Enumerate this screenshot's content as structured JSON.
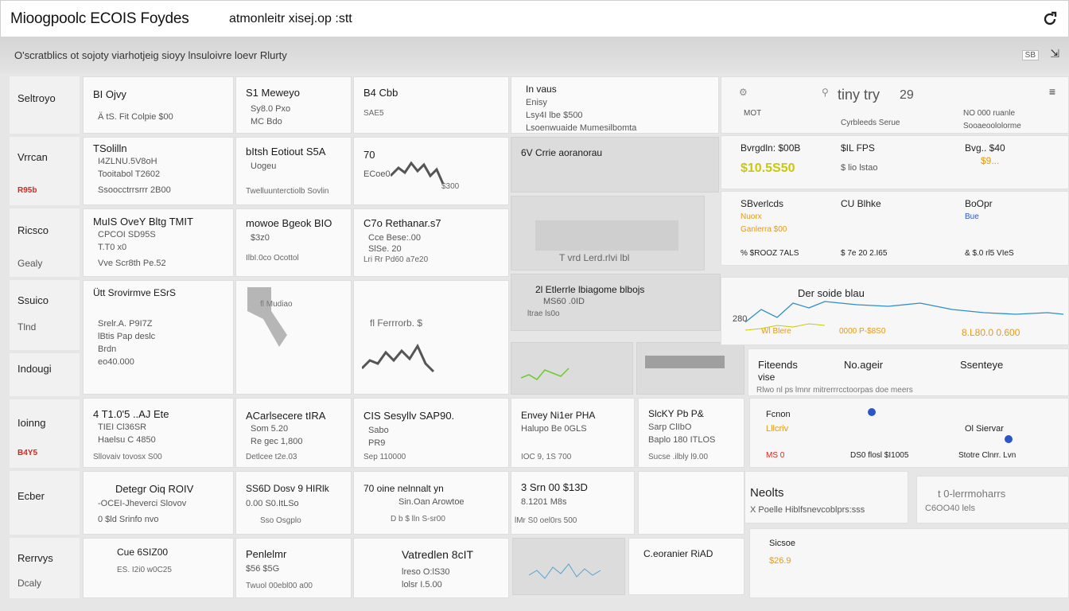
{
  "window": {
    "title": "Mioogpoolc  ECOIS  Foydes",
    "subtitle": "atmonleitr xisej.op :stt",
    "refresh_icon": "refresh-icon"
  },
  "subbar": {
    "text": "O'scratblics ot sojoty viarhotjeig sioyy lnsuloivre loevr Rlurty",
    "badge": "SB",
    "collapse_icon": "collapse-icon"
  },
  "rows": [
    {
      "label": "Seltroyo"
    },
    {
      "label": "Vrrcan",
      "sub": "R95b"
    },
    {
      "label": "Ricsco",
      "sub": "Gealy"
    },
    {
      "label": "Ssuico",
      "sub": "Tlnd"
    },
    {
      "label": "Indougi"
    },
    {
      "label": "Ioinng",
      "sub": "B4Y5"
    },
    {
      "label": "Ecber"
    },
    {
      "label": "Rerrvys",
      "sub": "Dcaly"
    }
  ],
  "cells": {
    "r1c1": {
      "h": "BI Ojvy",
      "l1": "Ä  tS. Fit Colpie $00"
    },
    "r1c2": {
      "h": "S1 Meweyo",
      "l1": "Sy8.0 Pxo",
      "l2": "MC Bdo"
    },
    "r1c3": {
      "h": "B4  Cbb",
      "l1": "SAE5"
    },
    "r1c4": {
      "h": "In vaus",
      "l1": "Enisy",
      "l2": "Lsy4I lbe  $500",
      "l3": "Lsoenwuaide Mumesilbomta"
    },
    "r2c1": {
      "h": "TSolilln",
      "l1": "I4ZLNU.5V8oH",
      "l2": "Tooitabol T2602",
      "l3": "Ssoocctrrsrrr 2B00"
    },
    "r2c2": {
      "h": "bItsh Eotiout S5A",
      "l1": "Uogeu",
      "l2": "Twelluunterctiolb Sovlin"
    },
    "r2c3": {
      "h": "70",
      "l1": "ECoe0",
      "l2": "$300"
    },
    "r2c4": {
      "h": "6V  Crrie aoranorau"
    },
    "r3c1": {
      "h": "MuIS OveY  Bltg TMIT",
      "l1": "CPCOI SD95S",
      "l2": "T.T0 x0",
      "l3": "Vve Scr8th Pe.52"
    },
    "r3c2": {
      "h": "mowoe  Bgeok BIO",
      "l1": "$3z0",
      "l2": "IlbI.0co Ocottol"
    },
    "r3c3": {
      "h": "C7o  Rethanar.s7",
      "l1": "Cce Bese:.00",
      "l2": "SlSe. 20",
      "l3": "Lri  Rr Pd60 a7e20"
    },
    "r3c4": {
      "h": "T  vrd  Lerd.rlvi lbl"
    },
    "r4c1": {
      "h": "Ütt  Srovirmve ESrS",
      "l1": "Srelr.A.  P9I7Z",
      "l2": "lBtis Pap deslc",
      "l3": "Brdn",
      "l4": "eo40.000"
    },
    "r4c2": {
      "h": "fl Mudiao"
    },
    "r4c3": {
      "h": "fl  Ferrrorb. $"
    },
    "r4c4": {
      "h": "2l  Etlerrle lbiagome blbojs",
      "l1": "MS60 .0ID",
      "l2": "ltrae ls0o"
    },
    "r5c1": {
      "h": "4  T1.0'5 ..AJ Ete",
      "l1": "TIEI  Cl36SR",
      "l2": "Haelsu C 4850",
      "l3": "Sllovaiv tovosx S00"
    },
    "r5c2": {
      "h": "ACarlsecere  tIRA",
      "l1": "Som 5.20",
      "l2": "Re gec 1,800",
      "l3": "Detlcee t2e.03"
    },
    "r5c3": {
      "h": "CIS  Sesyllv SAP90.",
      "l1": "Sabo",
      "l2": "PR9 ",
      "l3": "Sep 110000"
    },
    "r5c4": {
      "h": "Envey Ni1er PHA",
      "l1": "Halupo Be 0GLS",
      "l2": "IOC  9, 1S 700"
    },
    "r5c5": {
      "h": "SlcKY  Pb  P&",
      "l1": "Sarp ClIbO",
      "l2": "Baplo 180 ITLOS",
      "l3": "Sucse .ilbly l9.00"
    },
    "r6c1": {
      "h": "Detegr Oiq ROIV",
      "l1": "-OCEI-Jheverci Slovov",
      "l2": "0 $ld  Srinfo nvo"
    },
    "r6c2": {
      "h": "SS6D  Dosv  9 HIRlk",
      "l1": "0.00 S0.ItLSo",
      "l2": "Sso Osgplo"
    },
    "r6c3": {
      "h": "70  oine nelnnalt yn",
      "l1": "Sin.Oan Arowtoe",
      "l2": "D  b  $ lln S-sr00"
    },
    "r6c4": {
      "h": "3 Srn 00  $13D",
      "l1": "8.1201  M8s",
      "l2": "lMr S0 oel0rs 500"
    },
    "r7c1": {
      "h": "Cue 6SIZ00",
      "l1": "ES.  I2i0 w0C25"
    },
    "r7c2": {
      "h": "Penlelmr",
      "l1": "$56  $5G",
      "l2": "Twuol 00ebl00 a00"
    },
    "r7c3": {
      "h": "Vatredlen  8cIT",
      "l1": "lreso  O:lS30",
      "l2": "lolsr  I.5.00"
    },
    "r7c5": {
      "h": "C.eoranier  RiAD"
    }
  },
  "right": {
    "top_search": "tiny try",
    "top_num": "29",
    "menu_icon": "menu-icon",
    "r1": {
      "a": "MOT",
      "b": "Cyrbleeds  Serue",
      "c": "NO 000 ruanle",
      "d": "Sooaeoololorme"
    },
    "r2": {
      "a": "Bvrgdln: $00B",
      "a2": "$10.5S50",
      "b": "$IL  FPS",
      "b2": "$ lio  lstao",
      "c": "Bvg..  $40",
      "c2": "$9..."
    },
    "r3": {
      "a": "SBverlcds",
      "a2": "Nuorx",
      "a3": "Ganlerra  $00",
      "a4": "% $ROOZ 7ALS",
      "b": "CU Blhke",
      "b2": "$ 7e 20 2.I65",
      "c": "BoOpr",
      "c2": "Bue",
      "c3": "& $.0 rl5 VIeS"
    },
    "r4": {
      "title": "Der soide blau",
      "a": "280",
      "b": "Wl  Blere",
      "c": "0000  P-$8S0",
      "d": "8.L80.0  0.600"
    },
    "r5": {
      "a": "Fiteends",
      "a2": "vise",
      "b": "No.ageir",
      "c": "Ssenteye",
      "d": "Rlwo nl ps  lmnr mitrerrrcctoorpas doe meers"
    },
    "r6": {
      "a": "Fcnon",
      "a2": "Lllcriv",
      "a3": "MS 0",
      "b": "DS0 flosl $I1005",
      "c": "Ol  Siervar",
      "c2": "Stotre  Clnrr. Lvn"
    },
    "r7": {
      "a": "Neolts",
      "a2": "X Poelle Hiblfsnevcoblprs:sss",
      "b": "t 0-lerrmoharrs",
      "b2": "C6OO40  lels"
    },
    "r8": {
      "a": "Sicsoe",
      "a2": "$26.9"
    }
  },
  "colors": {
    "accent_orange": "#e39a1a",
    "accent_yellow": "#c9c90a",
    "accent_blue": "#2b56c5",
    "accent_green": "#6acb2a",
    "accent_red": "#d9261c"
  }
}
